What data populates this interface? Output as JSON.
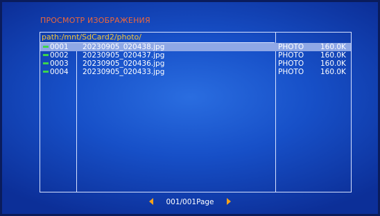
{
  "title": "ПРОСМОТР ИЗОБРАЖЕНИЯ",
  "path": "path:/mnt/SdCard2/photo/",
  "files": [
    {
      "index": "0001",
      "name": "20230905_020438.jpg",
      "type": "PHOTO",
      "size": "160.0K",
      "selected": true
    },
    {
      "index": "0002",
      "name": "20230905_020437.jpg",
      "type": "PHOTO",
      "size": "160.0K",
      "selected": false
    },
    {
      "index": "0003",
      "name": "20230905_020436.jpg",
      "type": "PHOTO",
      "size": "160.0K",
      "selected": false
    },
    {
      "index": "0004",
      "name": "20230905_020433.jpg",
      "type": "PHOTO",
      "size": "160.0K",
      "selected": false
    }
  ],
  "pager": {
    "label": "001/001Page",
    "prev_icon": "left-arrow-icon",
    "next_icon": "right-arrow-icon"
  },
  "colors": {
    "background": "#1750c8",
    "title": "#f0673a",
    "path": "#f0c43b",
    "selection": "#8fa8e6",
    "file_indicator": "#3cd64a",
    "arrows": "#f4a11a"
  }
}
